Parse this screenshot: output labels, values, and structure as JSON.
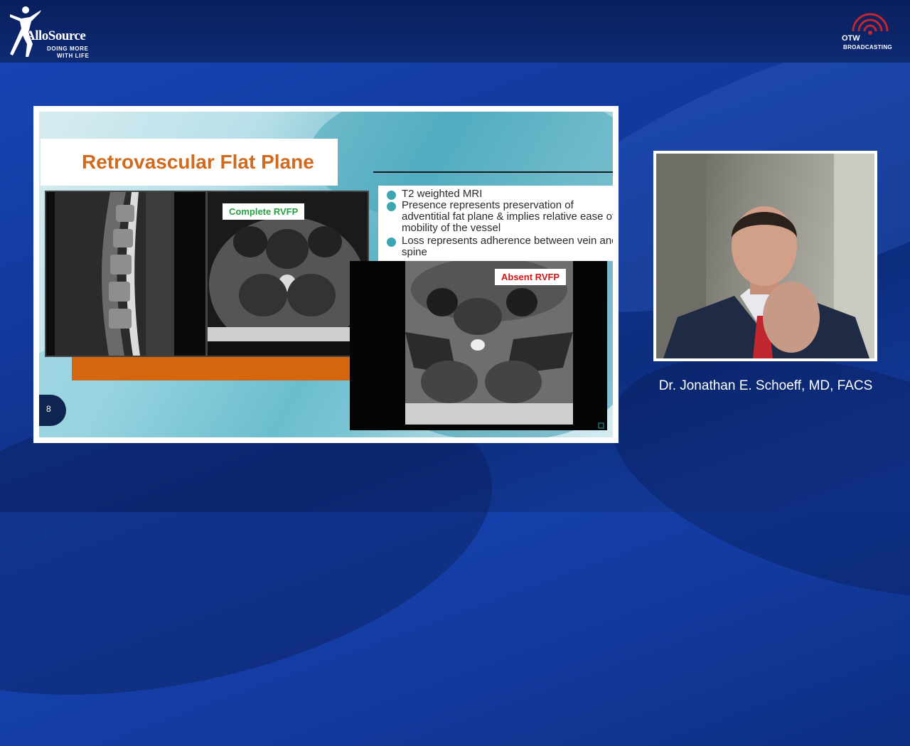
{
  "brand": {
    "left_logo_name": "AlloSource",
    "left_logo_tagline_1": "DOING MORE",
    "left_logo_tagline_2": "WITH LIFE",
    "right_logo_otw": "OTW",
    "right_logo_sub": "BROADCASTING"
  },
  "slide": {
    "title": "Retrovascular Flat Plane",
    "bullets": [
      "T2 weighted MRI",
      "Presence represents preservation of adventitial fat plane & implies relative ease of mobility of the vessel",
      "Loss represents adherence between vein and spine"
    ],
    "label_complete": "Complete RVFP",
    "label_absent": "Absent RVFP",
    "page_number": "8"
  },
  "speaker": {
    "name": "Dr. Jonathan E. Schoeff, MD, FACS"
  },
  "colors": {
    "title_orange": "#cf6a1e",
    "bullet_teal": "#3aa6b0",
    "complete_green": "#27a043",
    "absent_red": "#d01818",
    "background_blue": "#1846b8"
  }
}
